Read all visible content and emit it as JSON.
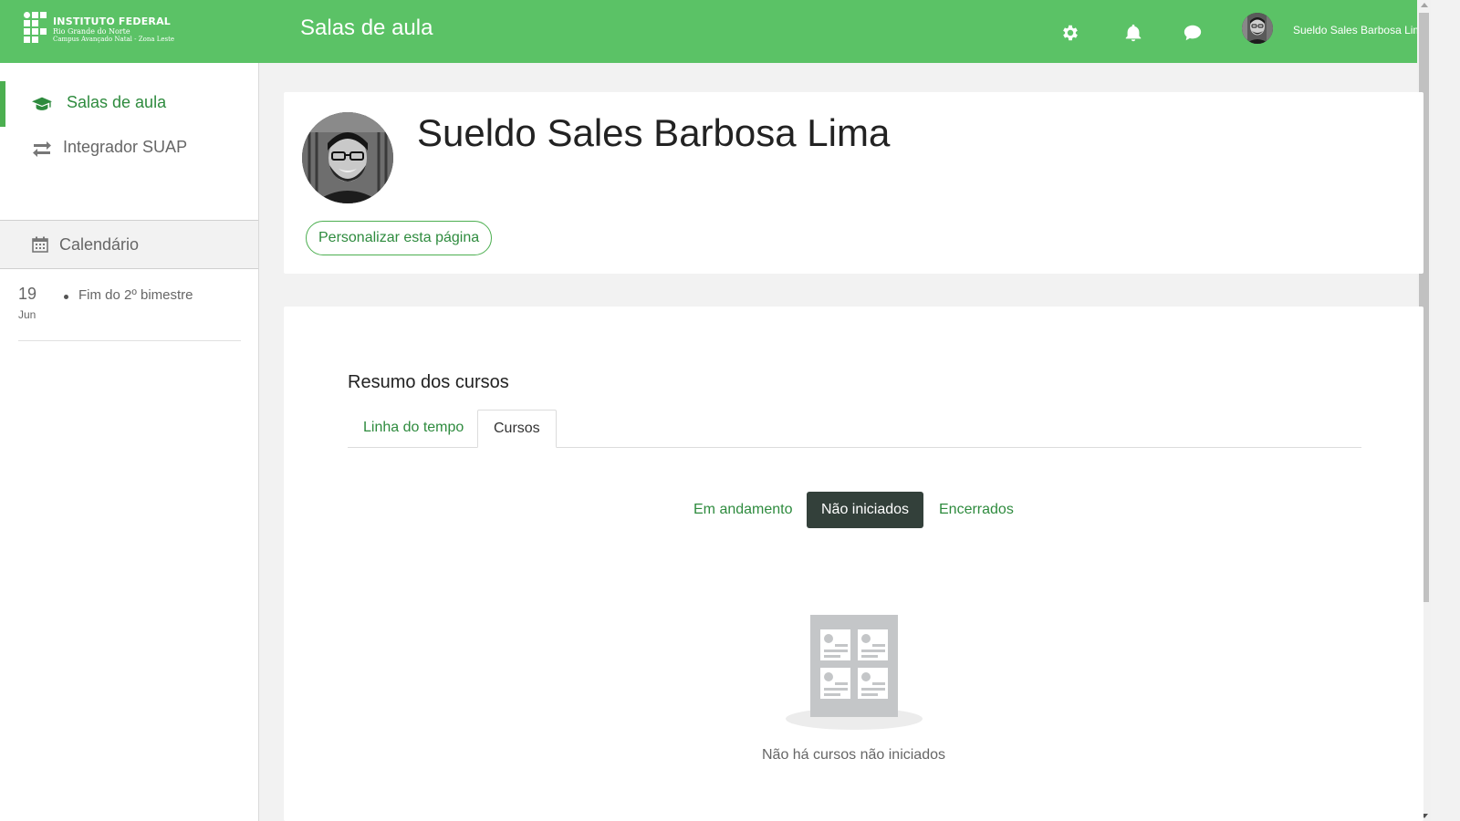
{
  "header": {
    "institution_line1": "INSTITUTO FEDERAL",
    "institution_line2": "Rio Grande do Norte",
    "institution_line3": "Campus Avançado Natal - Zona Leste",
    "page_title": "Salas de aula",
    "icons": [
      "gear-icon",
      "bell-icon",
      "chat-icon"
    ],
    "user_name": "Sueldo Sales Barbosa Lima",
    "color": "#5bc266"
  },
  "sidebar": {
    "items": [
      {
        "label": "Salas de aula",
        "icon": "graduation-cap-icon",
        "active": true
      },
      {
        "label": "Integrador SUAP",
        "icon": "exchange-arrows-icon",
        "active": false
      }
    ],
    "calendar": {
      "title": "Calendário",
      "icon": "calendar-icon",
      "events": [
        {
          "day": "19",
          "month": "Jun",
          "name": "Fim do 2º bimestre"
        }
      ]
    }
  },
  "profile": {
    "name": "Sueldo Sales Barbosa Lima",
    "customize_label": "Personalizar esta página"
  },
  "courses": {
    "title": "Resumo dos cursos",
    "tabs": [
      {
        "label": "Linha do tempo",
        "active": false
      },
      {
        "label": "Cursos",
        "active": true
      }
    ],
    "filters": [
      {
        "label": "Em andamento",
        "selected": false
      },
      {
        "label": "Não iniciados",
        "selected": true
      },
      {
        "label": "Encerrados",
        "selected": false
      }
    ],
    "empty_message": "Não há cursos não iniciados"
  },
  "colors": {
    "accent": "#4caf50",
    "link": "#2e8b3e",
    "selected_filter": "#33403a"
  }
}
